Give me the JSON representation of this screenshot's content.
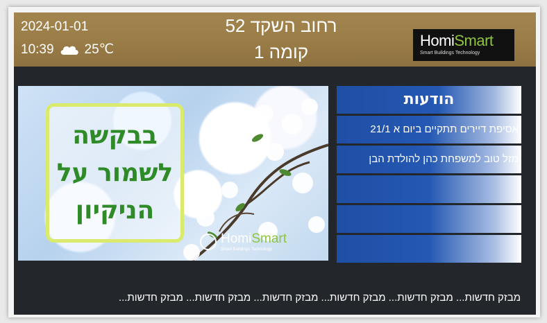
{
  "header": {
    "date": "2024-01-01",
    "time": "10:39",
    "weather_icon": "cloud-icon",
    "temperature": "25℃",
    "address": "רחוב השקד 52",
    "floor": "קומה 1",
    "logo": {
      "word1": "Homi",
      "word2": "Smart",
      "tagline": "Smart Buildings Technology"
    }
  },
  "media": {
    "sign_lines": [
      "בבקשה",
      "לשמור על",
      "הניקיון"
    ],
    "watermark": {
      "word1": "Homi",
      "word2": "Smart",
      "tagline": "Smart Buildings Technology"
    }
  },
  "notices": {
    "title": "הודעות",
    "items": [
      "אסיפת דיירים תתקיים ביום א 21/1",
      "מזל טוב למשפחת כהן להולדת הבן",
      "",
      "",
      ""
    ]
  },
  "ticker": "מבזק חדשות... מבזק חדשות... מבזק חדשות... מבזק חדשות... מבזק חדשות... מבזק חדשות...",
  "colors": {
    "header_gold": "#9a7c46",
    "notice_blue": "#2458b3",
    "brand_green": "#8fc43f",
    "sign_green": "#2e8b28"
  }
}
